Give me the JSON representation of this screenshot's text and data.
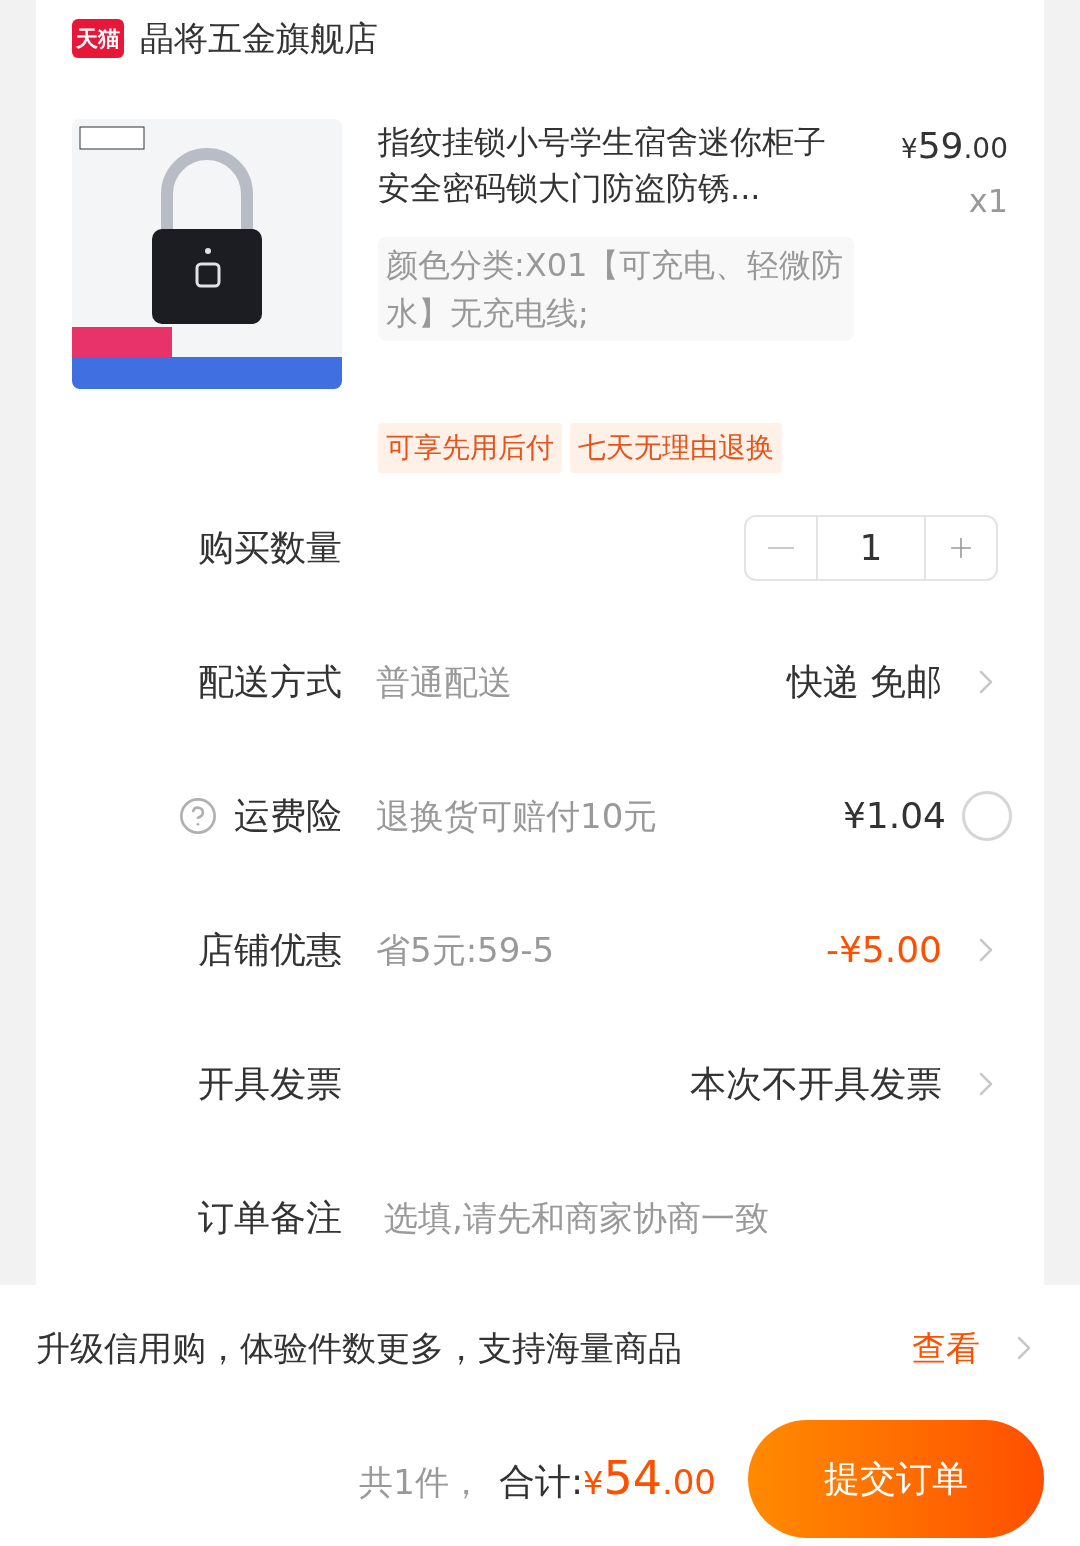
{
  "store": {
    "badge": "天猫",
    "name": "晶将五金旗舰店"
  },
  "product": {
    "title": "指纹挂锁小号学生宿舍迷你柜子安全密码锁大门防盗防锈...",
    "currency": "¥",
    "price": "59",
    "decimals": ".00",
    "quantity": "x1",
    "sku": "颜色分类:X01【可充电、轻微防水】无充电线;",
    "tags": [
      "可享先用后付",
      "七天无理由退换"
    ]
  },
  "rows": [
    {
      "kind": "quantity",
      "label": "购买数量",
      "value": "1"
    },
    {
      "kind": "link",
      "label": "配送方式",
      "detail": "普通配送",
      "value": "快递 免邮",
      "accent": false
    },
    {
      "kind": "option",
      "label": "运费险",
      "detail": "退换货可赔付10元",
      "value": "¥1.04",
      "checked": false
    },
    {
      "kind": "link",
      "label": "店铺优惠",
      "detail": "省5元:59-5",
      "value": "-¥5.00",
      "accent": true
    },
    {
      "kind": "link",
      "label": "开具发票",
      "value": "本次不开具发票",
      "accent": false
    },
    {
      "kind": "note",
      "label": "订单备注",
      "placeholder": "选填,请先和商家协商一致"
    }
  ],
  "banner": {
    "text": "升级信用购，体验件数更多，支持海量商品",
    "link": "查看"
  },
  "footer": {
    "count": "共1件，",
    "total_label": "合计:",
    "currency": "¥",
    "amount": "54",
    "decimals": ".00",
    "submit": "提交订单"
  }
}
